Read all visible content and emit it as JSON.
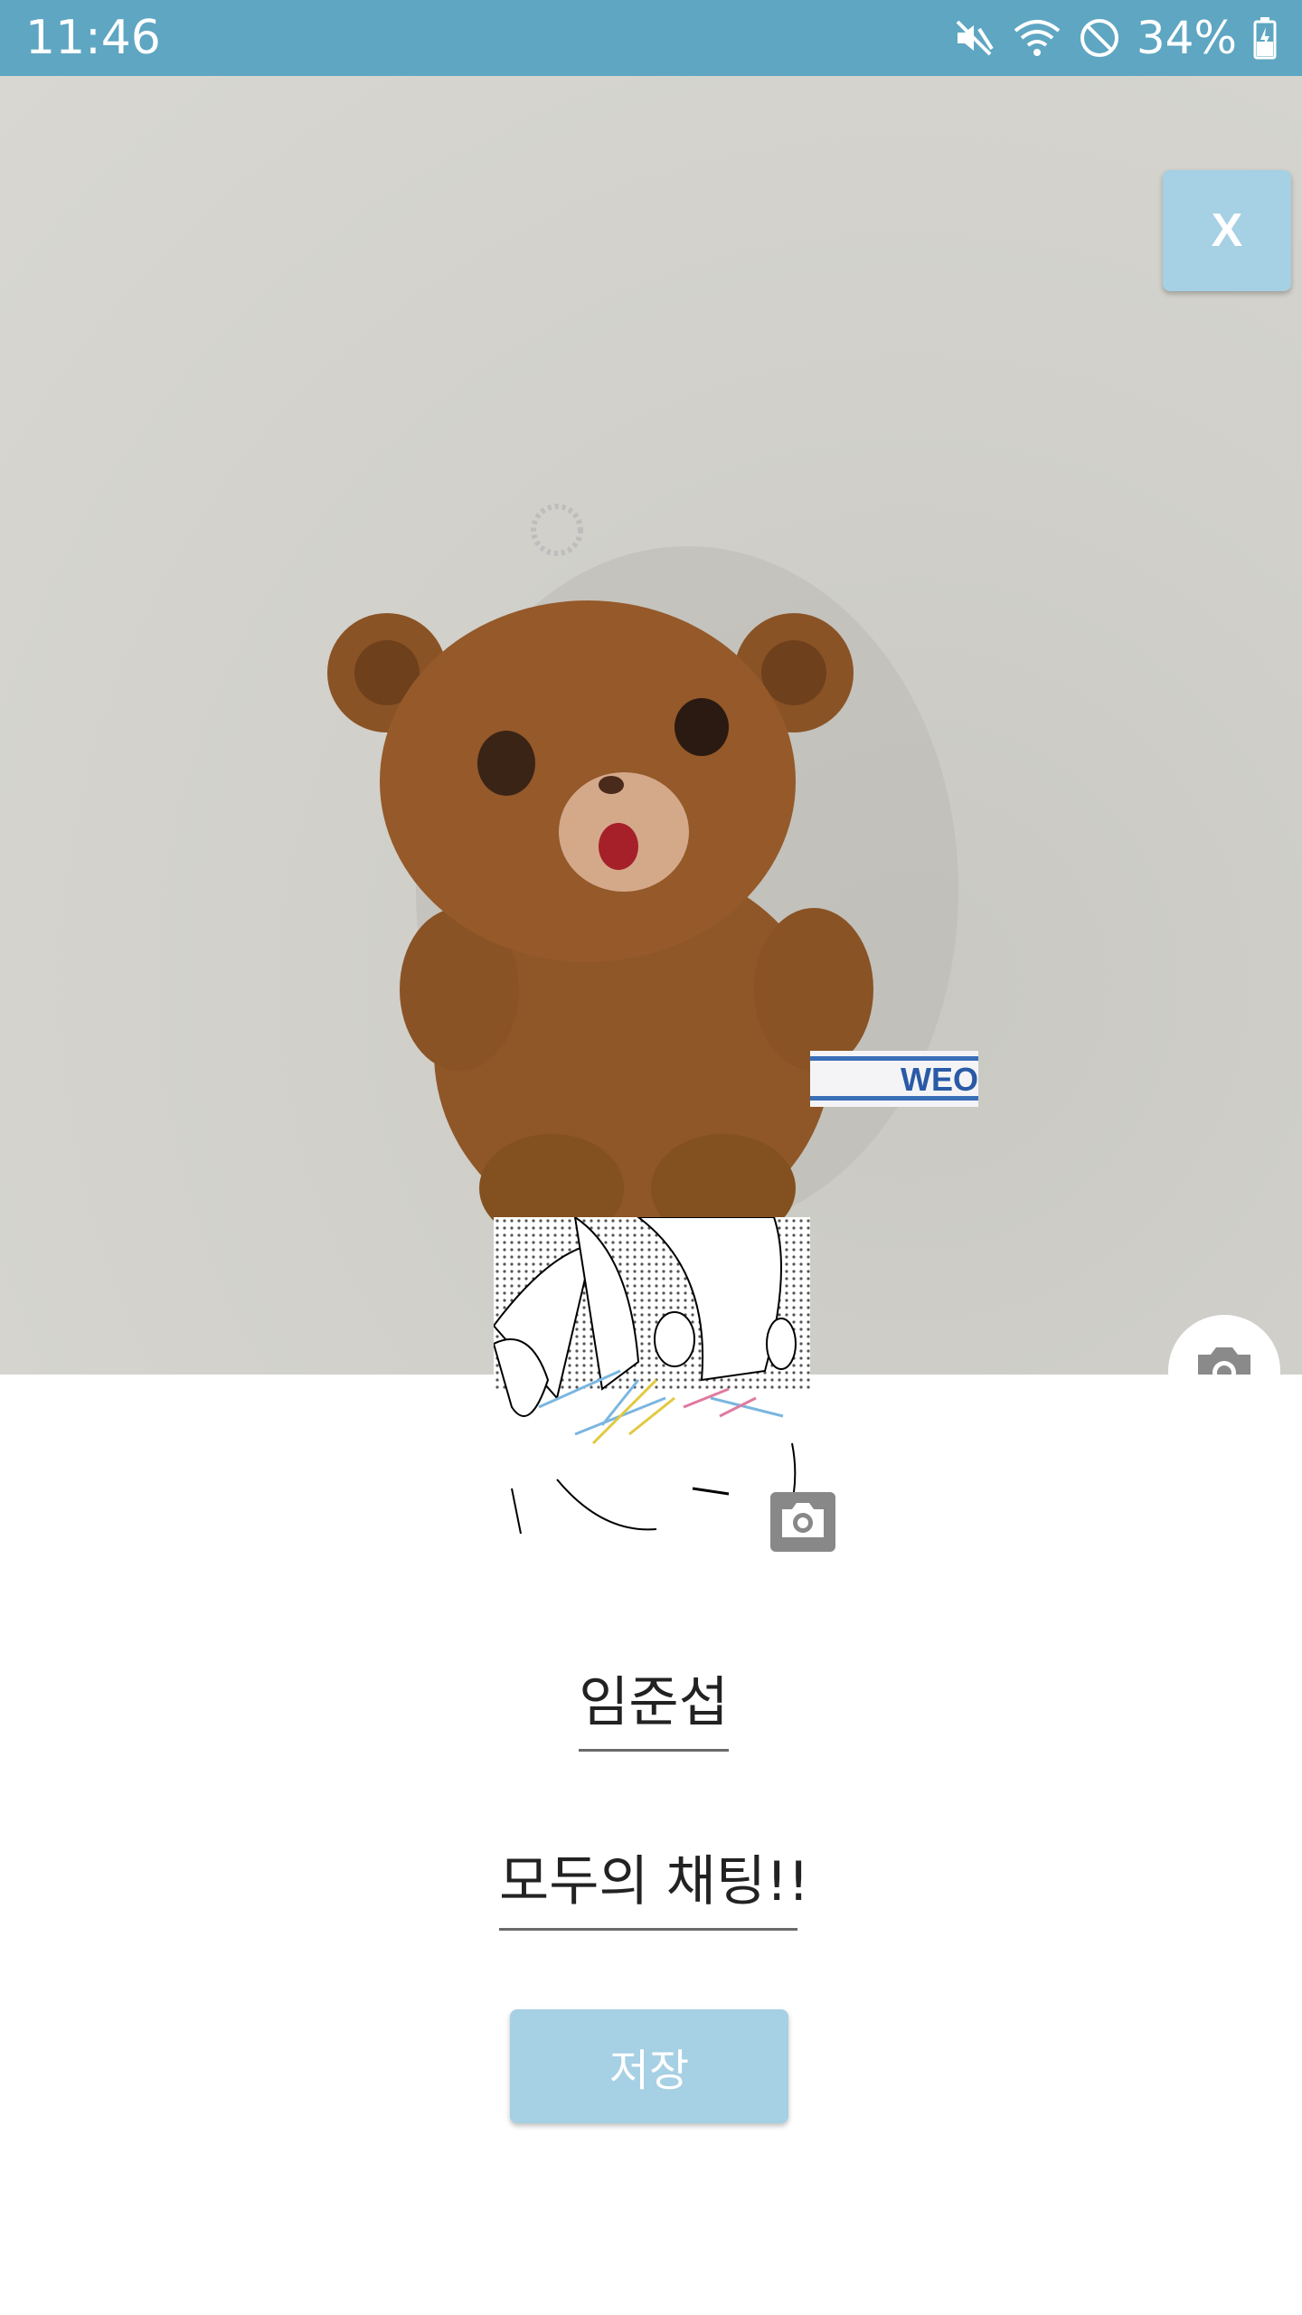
{
  "status_bar": {
    "time": "11:46",
    "battery": "34%",
    "icons": [
      "mute-icon",
      "wifi-icon",
      "do-not-disturb-icon",
      "battery-charging-icon"
    ]
  },
  "cover": {
    "close_label": "X",
    "image_description_icon": "teddy-bear-photo",
    "tag_text": "WEO",
    "camera_icon": "camera-icon"
  },
  "profile": {
    "camera_icon": "camera-icon",
    "name": "임준섭",
    "status_message": "모두의 채팅!!",
    "save_label": "저장"
  },
  "colors": {
    "status_bar": "#5ea6c2",
    "accent_button": "#a6d0e4"
  }
}
